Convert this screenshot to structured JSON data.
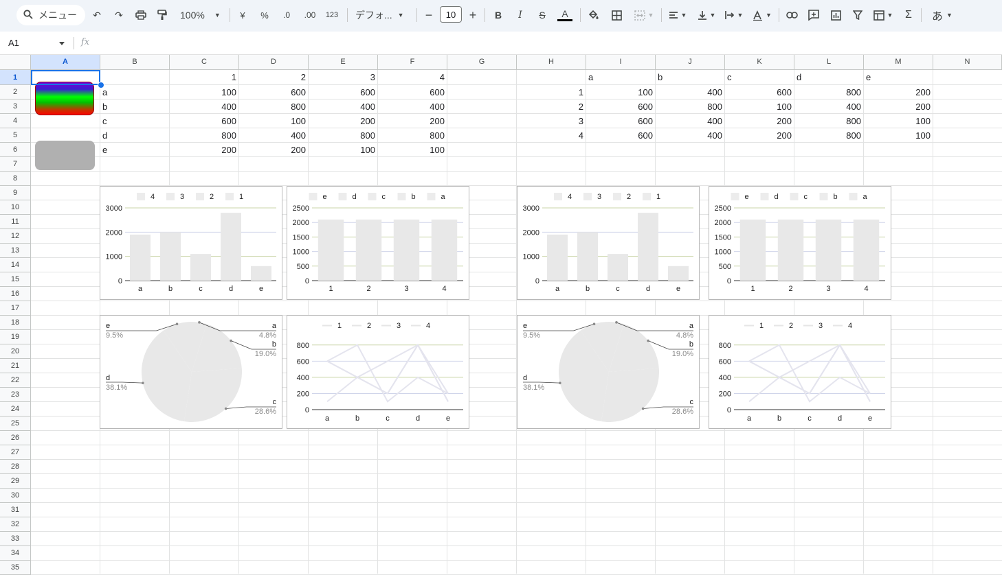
{
  "toolbar": {
    "menu_label": "メニュー",
    "zoom": "100%",
    "currency": "¥",
    "percent": "%",
    "decrease_decimal": ".0",
    "increase_decimal": ".00",
    "number_format": "123",
    "font_name": "デフォ...",
    "font_size": "10",
    "bold": "B",
    "italic": "I",
    "strikethrough": "S",
    "text_color": "A",
    "sum": "Σ",
    "input_tools": "あ"
  },
  "formula_bar": {
    "name_box": "A1",
    "fx": "fx"
  },
  "columns": [
    "A",
    "B",
    "C",
    "D",
    "E",
    "F",
    "G",
    "H",
    "I",
    "J",
    "K",
    "L",
    "M",
    "N"
  ],
  "selected_column": "A",
  "selected_row": "1",
  "rows": [
    "1",
    "2",
    "3",
    "4",
    "5",
    "6",
    "7",
    "8",
    "9",
    "10",
    "11",
    "12",
    "13",
    "14",
    "15",
    "16",
    "17",
    "18",
    "19",
    "20",
    "21",
    "22",
    "23",
    "24",
    "25",
    "26",
    "27",
    "28",
    "29",
    "30",
    "31",
    "32",
    "33",
    "34",
    "35"
  ],
  "table1": {
    "header": [
      "1",
      "2",
      "3",
      "4"
    ],
    "labels": [
      "a",
      "b",
      "c",
      "d",
      "e"
    ],
    "values": [
      [
        "100",
        "600",
        "600",
        "600"
      ],
      [
        "400",
        "800",
        "400",
        "400"
      ],
      [
        "600",
        "100",
        "200",
        "200"
      ],
      [
        "800",
        "400",
        "800",
        "800"
      ],
      [
        "200",
        "200",
        "100",
        "100"
      ]
    ]
  },
  "table2": {
    "header": [
      "a",
      "b",
      "c",
      "d",
      "e"
    ],
    "labels": [
      "1",
      "2",
      "3",
      "4"
    ],
    "values": [
      [
        "100",
        "400",
        "600",
        "800",
        "200"
      ],
      [
        "600",
        "800",
        "100",
        "400",
        "200"
      ],
      [
        "600",
        "400",
        "200",
        "800",
        "100"
      ],
      [
        "600",
        "400",
        "200",
        "800",
        "100"
      ]
    ]
  },
  "chart_data": [
    {
      "type": "bar",
      "categories": [
        "a",
        "b",
        "c",
        "d",
        "e"
      ],
      "legend": [
        "4",
        "3",
        "2",
        "1"
      ],
      "values": [
        1900,
        2000,
        1100,
        2800,
        600
      ],
      "yticks": [
        "3000",
        "2000",
        "1000",
        "0"
      ],
      "ylim": [
        0,
        3000
      ]
    },
    {
      "type": "bar",
      "categories": [
        "1",
        "2",
        "3",
        "4"
      ],
      "legend": [
        "e",
        "d",
        "c",
        "b",
        "a"
      ],
      "values": [
        2100,
        2100,
        2100,
        2100
      ],
      "yticks": [
        "2500",
        "2000",
        "1500",
        "1000",
        "500",
        "0"
      ],
      "ylim": [
        0,
        2500
      ]
    },
    {
      "type": "bar",
      "categories": [
        "a",
        "b",
        "c",
        "d",
        "e"
      ],
      "legend": [
        "4",
        "3",
        "2",
        "1"
      ],
      "values": [
        1900,
        2000,
        1100,
        2800,
        600
      ],
      "yticks": [
        "3000",
        "2000",
        "1000",
        "0"
      ],
      "ylim": [
        0,
        3000
      ]
    },
    {
      "type": "bar",
      "categories": [
        "1",
        "2",
        "3",
        "4"
      ],
      "legend": [
        "e",
        "d",
        "c",
        "b",
        "a"
      ],
      "values": [
        2100,
        2100,
        2100,
        2100
      ],
      "yticks": [
        "2500",
        "2000",
        "1500",
        "1000",
        "500",
        "0"
      ],
      "ylim": [
        0,
        2500
      ]
    },
    {
      "type": "pie",
      "labels": [
        "a",
        "b",
        "c",
        "d",
        "e"
      ],
      "values": [
        4.8,
        19.0,
        28.6,
        38.1,
        9.5
      ],
      "percent_labels": [
        "4.8%",
        "19.0%",
        "28.6%",
        "38.1%",
        "9.5%"
      ]
    },
    {
      "type": "line",
      "categories": [
        "a",
        "b",
        "c",
        "d",
        "e"
      ],
      "legend": [
        "1",
        "2",
        "3",
        "4"
      ],
      "series": [
        {
          "name": "1",
          "values": [
            100,
            400,
            600,
            800,
            200
          ]
        },
        {
          "name": "2",
          "values": [
            600,
            800,
            100,
            400,
            200
          ]
        },
        {
          "name": "3",
          "values": [
            600,
            400,
            200,
            800,
            100
          ]
        },
        {
          "name": "4",
          "values": [
            600,
            400,
            200,
            800,
            100
          ]
        }
      ],
      "yticks": [
        "800",
        "600",
        "400",
        "200",
        "0"
      ],
      "ylim": [
        0,
        900
      ]
    },
    {
      "type": "pie",
      "labels": [
        "a",
        "b",
        "c",
        "d",
        "e"
      ],
      "values": [
        4.8,
        19.0,
        28.6,
        38.1,
        9.5
      ],
      "percent_labels": [
        "4.8%",
        "19.0%",
        "28.6%",
        "38.1%",
        "9.5%"
      ]
    },
    {
      "type": "line",
      "categories": [
        "a",
        "b",
        "c",
        "d",
        "e"
      ],
      "legend": [
        "1",
        "2",
        "3",
        "4"
      ],
      "series": [
        {
          "name": "1",
          "values": [
            100,
            400,
            600,
            800,
            200
          ]
        },
        {
          "name": "2",
          "values": [
            600,
            800,
            100,
            400,
            200
          ]
        },
        {
          "name": "3",
          "values": [
            600,
            400,
            200,
            800,
            100
          ]
        },
        {
          "name": "4",
          "values": [
            600,
            400,
            200,
            800,
            100
          ]
        }
      ],
      "yticks": [
        "800",
        "600",
        "400",
        "200",
        "0"
      ],
      "ylim": [
        0,
        900
      ]
    }
  ]
}
